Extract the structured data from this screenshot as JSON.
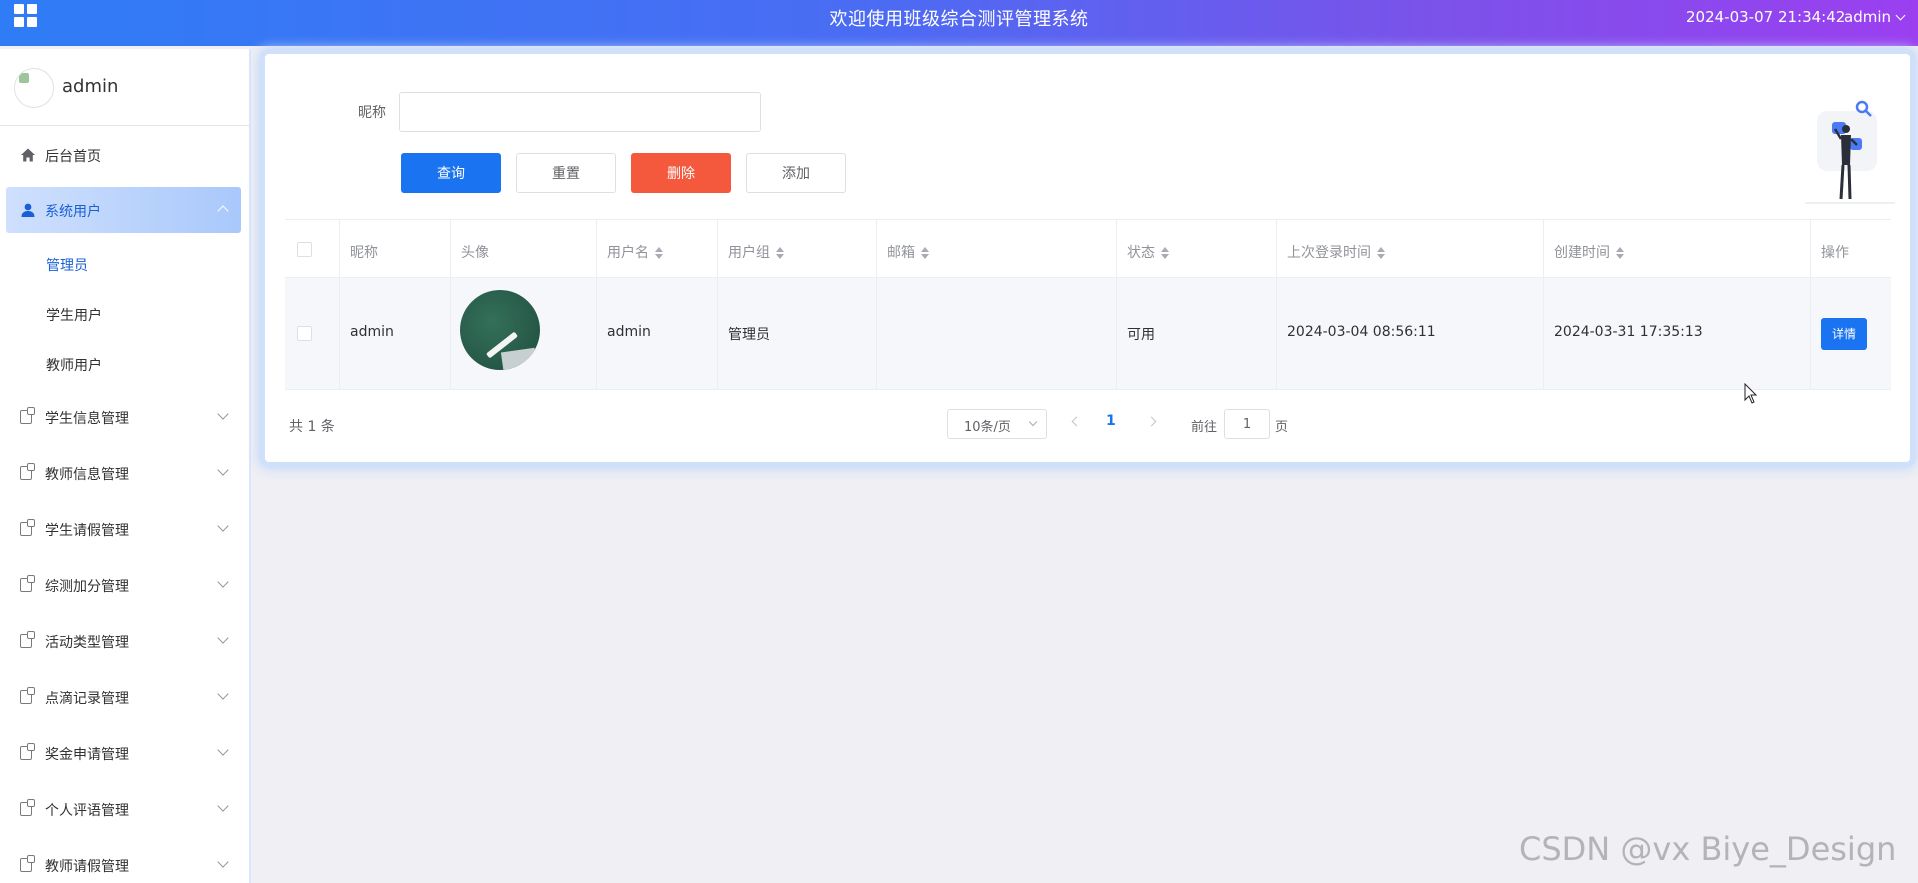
{
  "header": {
    "title": "欢迎使用班级综合测评管理系统",
    "datetime": "2024-03-07 21:34:42",
    "user": "admin"
  },
  "sidebar": {
    "profile_name": "admin",
    "home": "后台首页",
    "system_users": "系统用户",
    "sub_items": [
      "管理员",
      "学生用户",
      "教师用户"
    ],
    "groups": [
      "学生信息管理",
      "教师信息管理",
      "学生请假管理",
      "综测加分管理",
      "活动类型管理",
      "点滴记录管理",
      "奖金申请管理",
      "个人评语管理",
      "教师请假管理"
    ]
  },
  "search": {
    "label": "昵称",
    "value": "",
    "placeholder": ""
  },
  "buttons": {
    "query": "查询",
    "reset": "重置",
    "delete": "删除",
    "add": "添加"
  },
  "table": {
    "headers": [
      "昵称",
      "头像",
      "用户名",
      "用户组",
      "邮箱",
      "状态",
      "上次登录时间",
      "创建时间",
      "操作"
    ],
    "rows": [
      {
        "nickname": "admin",
        "username": "admin",
        "group": "管理员",
        "email": "",
        "status": "可用",
        "last_login": "2024-03-04 08:56:11",
        "created": "2024-03-31 17:35:13",
        "action": "详情"
      }
    ]
  },
  "pagination": {
    "total": "共 1 条",
    "page_size": "10条/页",
    "current_page": "1",
    "goto_label": "前往",
    "goto_value": "1",
    "goto_unit": "页"
  },
  "watermark": "CSDN @vx  Biye_Design",
  "colors": {
    "primary": "#1a73f0",
    "danger": "#f4593d",
    "header_start": "#2f7cf6",
    "header_end": "#9b3ff0"
  }
}
